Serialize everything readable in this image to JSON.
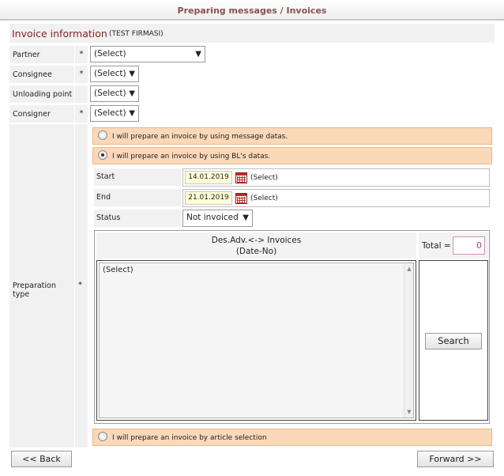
{
  "header": {
    "title": "Preparing messages / Invoices"
  },
  "section": {
    "title": "Invoice information",
    "company": "(TEST FIRMASI)"
  },
  "form": {
    "partner": {
      "label": "Partner",
      "required": "*",
      "value": "(Select)"
    },
    "consignee": {
      "label": "Consignee",
      "required": "*",
      "value": "(Select)"
    },
    "unloading": {
      "label": "Unloading point",
      "required": "",
      "value": "(Select)"
    },
    "consigner": {
      "label": "Consigner",
      "required": "*",
      "value": "(Select)"
    },
    "prep_type": {
      "label": "Preparation type",
      "required": "*"
    }
  },
  "options": {
    "message_datas": {
      "label": "I will prepare an invoice by using message datas.",
      "selected": false
    },
    "bl_datas": {
      "label": "I will prepare an invoice by using BL's datas.",
      "selected": true
    },
    "article": {
      "label": "I will prepare an invoice by article selection",
      "selected": false
    }
  },
  "bl": {
    "start": {
      "label": "Start",
      "value": "14.01.2019",
      "link": "(Select)"
    },
    "end": {
      "label": "End",
      "value": "21.01.2019",
      "link": "(Select)"
    },
    "status": {
      "label": "Status",
      "value": "Not invoiced"
    },
    "list": {
      "header_line1": "Des.Adv.<-> Invoices",
      "header_line2": "(Date-No)",
      "items": [
        "(Select)"
      ]
    },
    "total": {
      "label": "Total =",
      "value": "0"
    },
    "search_label": "Search"
  },
  "nav": {
    "back_label": "<< Back",
    "forward_label": "Forward >>"
  },
  "icons": {
    "dropdown": "chevron-down-icon",
    "calendar": "calendar-icon",
    "radio": "radio-button"
  },
  "colors": {
    "header_text": "#8a5050",
    "section_title": "#8a1f1f",
    "option_bg": "#fbd8b8",
    "date_bg": "#ffffd8",
    "total_text": "#d02f7a"
  }
}
